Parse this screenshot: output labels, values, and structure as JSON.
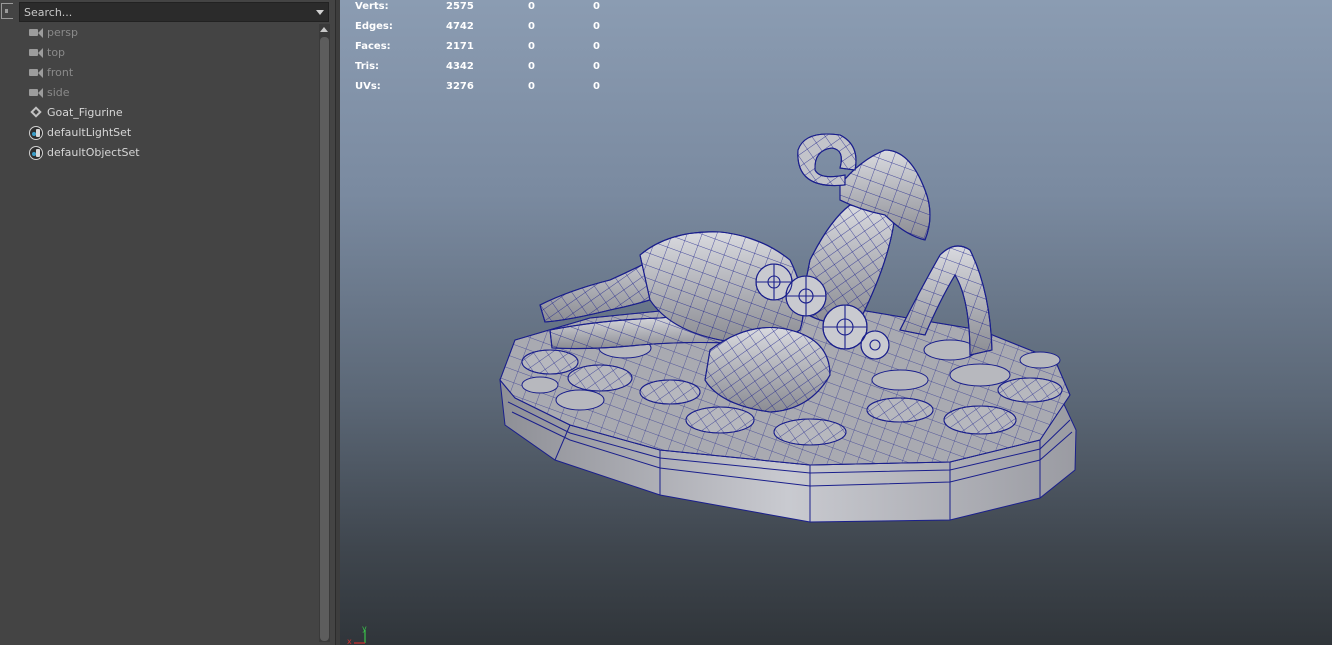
{
  "outliner": {
    "search_placeholder": "Search...",
    "items": [
      {
        "label": "persp",
        "icon": "camera-icon"
      },
      {
        "label": "top",
        "icon": "camera-icon"
      },
      {
        "label": "front",
        "icon": "camera-icon"
      },
      {
        "label": "side",
        "icon": "camera-icon"
      },
      {
        "label": "Goat_Figurine",
        "icon": "transform-icon"
      },
      {
        "label": "defaultLightSet",
        "icon": "set-icon"
      },
      {
        "label": "defaultObjectSet",
        "icon": "set-icon"
      }
    ]
  },
  "viewport": {
    "hud": [
      {
        "label": "Verts:",
        "value": "2575",
        "sel": "0",
        "comp": "0"
      },
      {
        "label": "Edges:",
        "value": "4742",
        "sel": "0",
        "comp": "0"
      },
      {
        "label": "Faces:",
        "value": "2171",
        "sel": "0",
        "comp": "0"
      },
      {
        "label": "Tris:",
        "value": "4342",
        "sel": "0",
        "comp": "0"
      },
      {
        "label": "UVs:",
        "value": "3276",
        "sel": "0",
        "comp": "0"
      }
    ],
    "axis": {
      "x": "x",
      "y": "y"
    },
    "colors": {
      "wire": "#1a1f8c",
      "x_axis": "#d23030",
      "y_axis": "#39c24a"
    }
  }
}
